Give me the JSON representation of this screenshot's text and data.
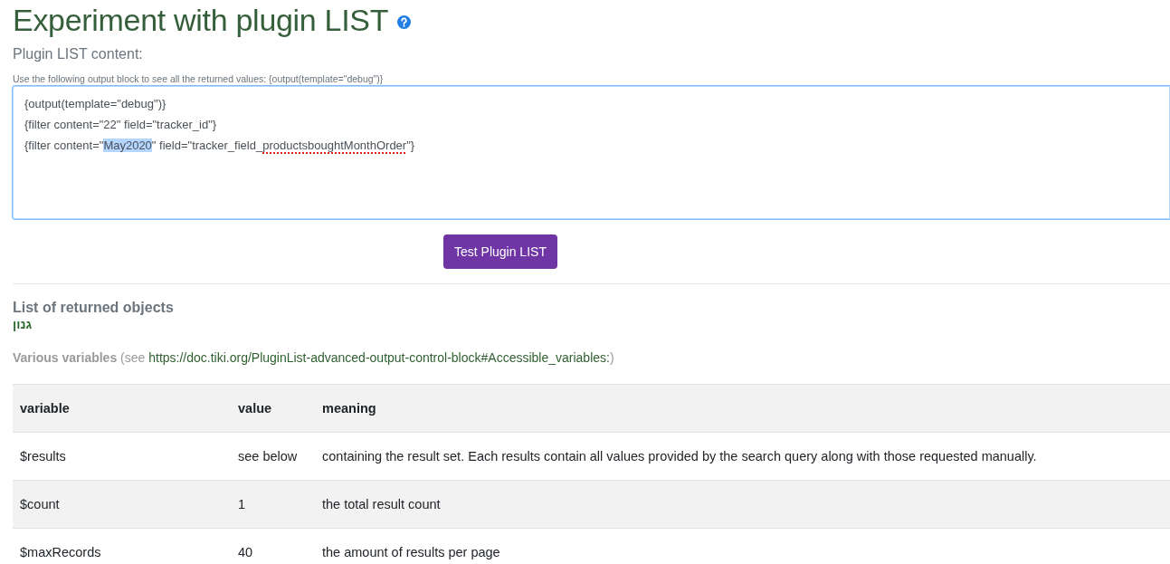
{
  "page": {
    "title": "Experiment with plugin LIST"
  },
  "form": {
    "label": "Plugin LIST content:",
    "hint": "Use the following output block to see all the returned values: {output(template=\"debug\")}",
    "editor": {
      "focused": true,
      "lines": [
        {
          "segments": [
            {
              "kind": "plain",
              "text": "{output(template=\"debug\")}"
            }
          ]
        },
        {
          "segments": [
            {
              "kind": "plain",
              "text": "{filter content=\"22\" field=\"tracker_id\"}"
            }
          ]
        },
        {
          "segments": [
            {
              "kind": "plain",
              "text": "{filter content=\""
            },
            {
              "kind": "selected",
              "text": "May2020"
            },
            {
              "kind": "plain",
              "text": "\" field=\"tracker_field_"
            },
            {
              "kind": "misspelled",
              "text": "productsboughtMonthOrder"
            },
            {
              "kind": "plain",
              "text": "\"}"
            }
          ]
        }
      ]
    },
    "submit_button": "Test Plugin LIST"
  },
  "results": {
    "heading": "List of returned objects",
    "value": "גנון",
    "variables_note": {
      "label": "Various variables",
      "prefix": "(see",
      "link": "https://doc.tiki.org/PluginList-advanced-output-control-block#Accessible_variables:",
      "suffix": ")"
    }
  },
  "table": {
    "columns": [
      "variable",
      "value",
      "meaning"
    ],
    "rows": [
      [
        "$results",
        "see below",
        "containing the result set. Each results contain all values provided by the search query along with those requested manually."
      ],
      [
        "$count",
        "1",
        "the total result count"
      ],
      [
        "$maxRecords",
        "40",
        "the amount of results per page"
      ]
    ]
  }
}
